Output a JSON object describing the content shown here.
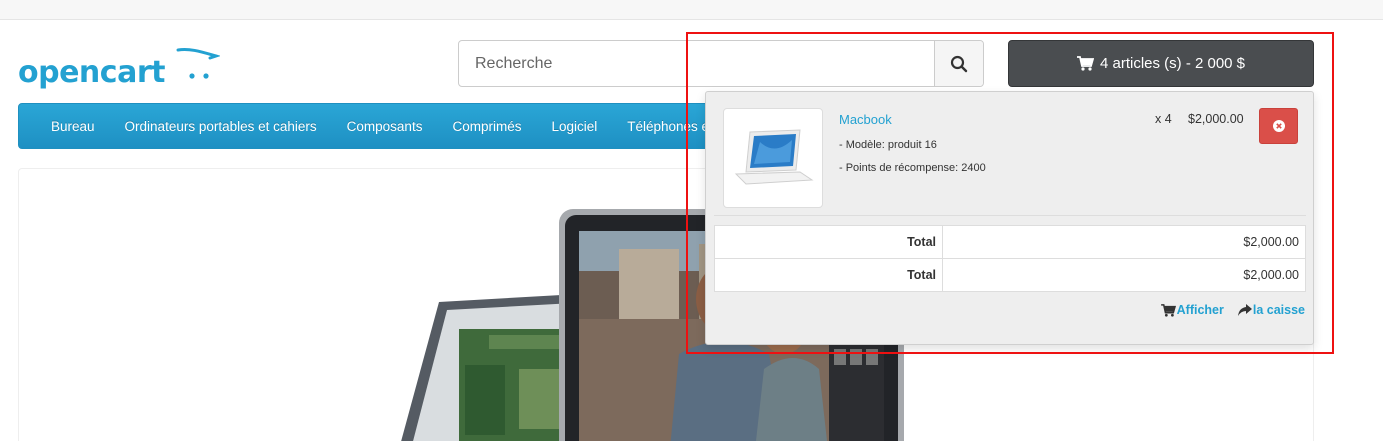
{
  "header": {
    "logo_text": "opencart",
    "search": {
      "placeholder": "Recherche",
      "value": ""
    },
    "cart_button_label": "4 articles (s) - 2 000 $"
  },
  "nav": {
    "items": [
      {
        "label": "Bureau"
      },
      {
        "label": "Ordinateurs portables et cahiers"
      },
      {
        "label": "Composants"
      },
      {
        "label": "Comprimés"
      },
      {
        "label": "Logiciel"
      },
      {
        "label": "Téléphones et P"
      }
    ]
  },
  "cart_dropdown": {
    "product": {
      "name": "Macbook",
      "options": [
        "- Modèle: produit 16",
        "- Points de récompense: 2400"
      ],
      "quantity": "x 4",
      "price": "$2,000.00"
    },
    "totals": [
      {
        "label": "Total",
        "value": "$2,000.00"
      },
      {
        "label": "Total",
        "value": "$2,000.00"
      }
    ],
    "links": {
      "view": "Afficher",
      "checkout": "la caisse"
    }
  },
  "colors": {
    "brand": "#23a1d1",
    "cart_button": "#4a4d50",
    "remove_button": "#da4f49",
    "highlight": "#ee1111"
  },
  "icons": [
    "search-icon",
    "cart-icon",
    "remove-icon",
    "share-icon"
  ]
}
